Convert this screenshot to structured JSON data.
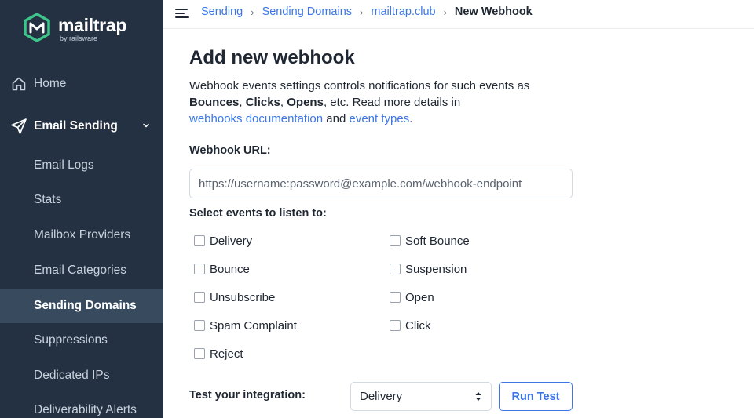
{
  "sidebar": {
    "logo_name": "mailtrap",
    "logo_sub": "by railsware",
    "home_label": "Home",
    "email_sending_label": "Email Sending",
    "items": [
      {
        "label": "Email Logs"
      },
      {
        "label": "Stats"
      },
      {
        "label": "Mailbox Providers"
      },
      {
        "label": "Email Categories"
      },
      {
        "label": "Sending Domains",
        "active": true
      },
      {
        "label": "Suppressions"
      },
      {
        "label": "Dedicated IPs"
      },
      {
        "label": "Deliverability Alerts"
      }
    ],
    "colors": {
      "background": "#233142",
      "active": "#384a5e",
      "logo": "#3ec48a"
    }
  },
  "breadcrumb": {
    "items": [
      "Sending",
      "Sending Domains",
      "mailtrap.club"
    ],
    "current": "New Webhook",
    "separator": "›"
  },
  "main": {
    "title": "Add new webhook",
    "desc": {
      "part1": "Webhook events settings controls notifications for such events as ",
      "bounces": "Bounces",
      "comma1": ", ",
      "clicks": "Clicks",
      "comma2": ", ",
      "opens": "Opens",
      "part2": ", etc. Read more details in ",
      "link1": "webhooks documentation",
      "and": " and ",
      "link2": "event types",
      "period": "."
    },
    "url_label": "Webhook URL:",
    "url_placeholder": "https://username:password@example.com/webhook-endpoint",
    "events_label": "Select events to listen to:",
    "events_left": [
      "Delivery",
      "Bounce",
      "Unsubscribe",
      "Spam Complaint",
      "Reject"
    ],
    "events_right": [
      "Soft Bounce",
      "Suspension",
      "Open",
      "Click"
    ],
    "test_label": "Test your integration:",
    "test_selected": "Delivery",
    "run_test_label": "Run Test",
    "accent": "#3c76e6"
  }
}
